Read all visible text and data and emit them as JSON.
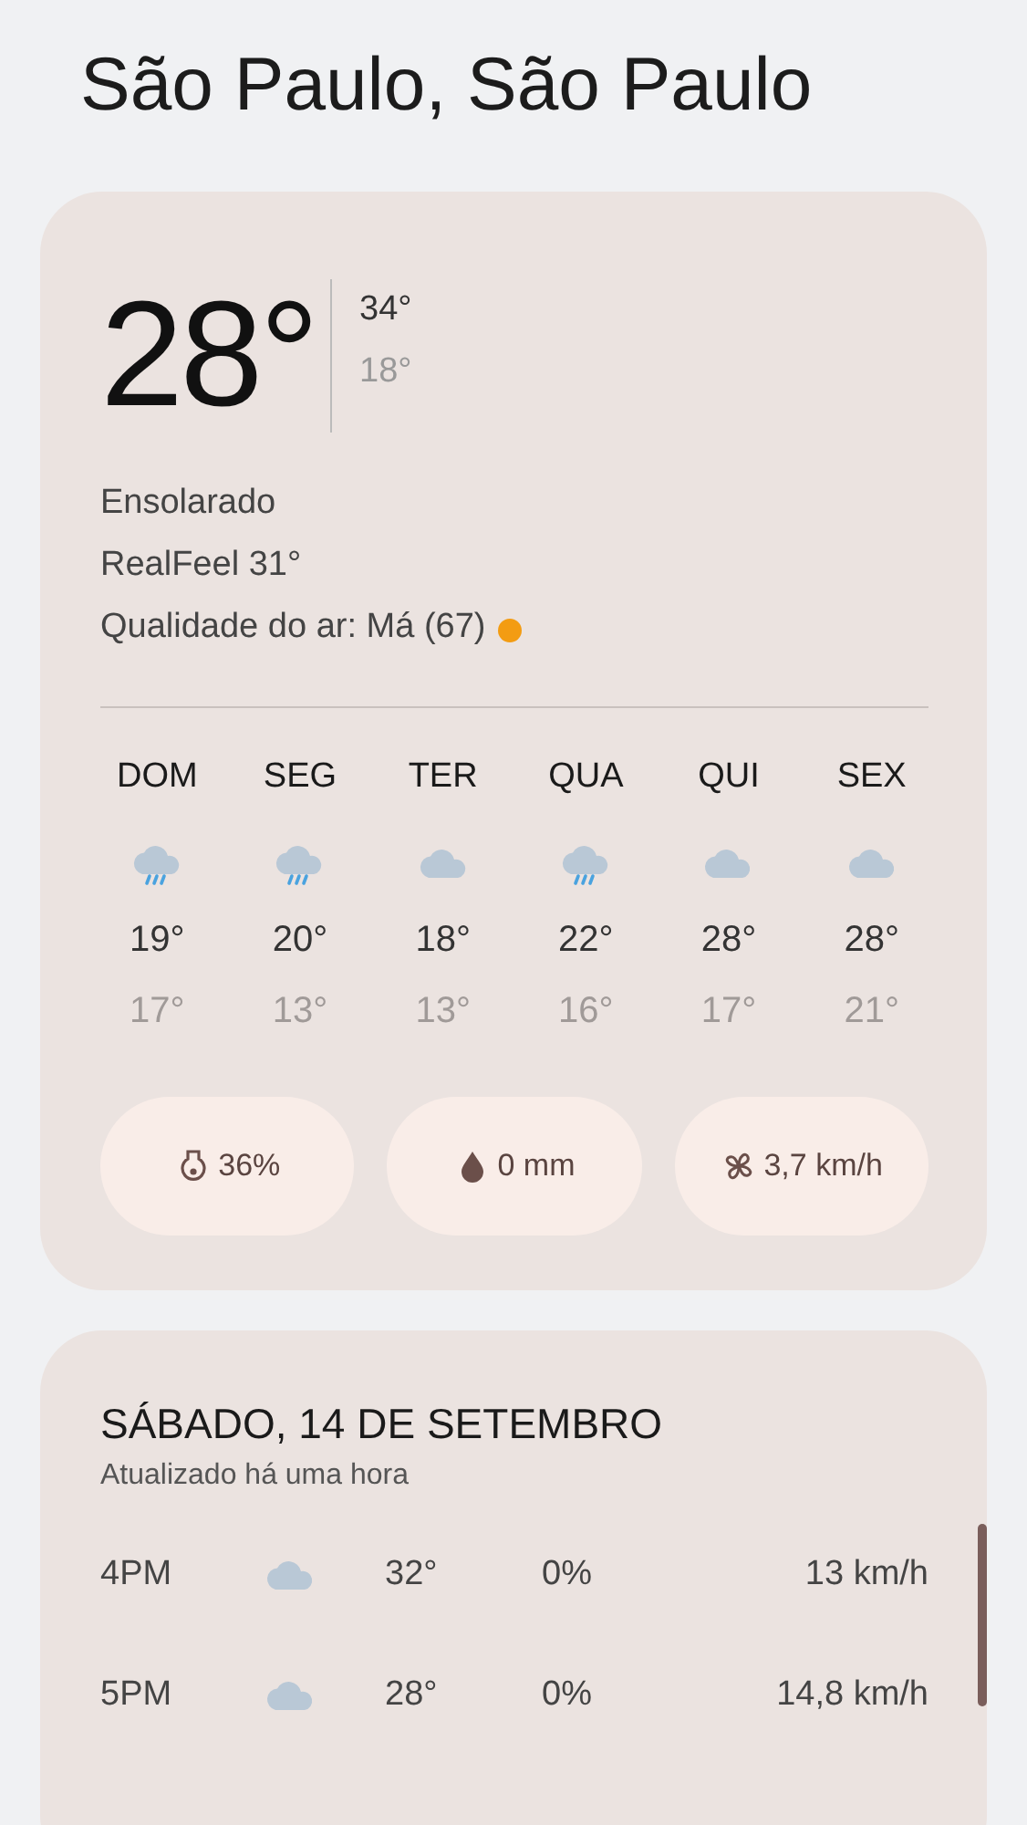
{
  "location": "São Paulo, São Paulo",
  "current": {
    "temperature": "28°",
    "high": "34°",
    "low": "18°",
    "condition": "Ensolarado",
    "realfeel": "RealFeel 31°",
    "air_quality": {
      "label": "Qualidade do ar: Má (67)",
      "color": "#f39c12"
    }
  },
  "forecast": [
    {
      "day": "DOM",
      "kind": "rain",
      "high": "19°",
      "low": "17°"
    },
    {
      "day": "SEG",
      "kind": "rain",
      "high": "20°",
      "low": "13°"
    },
    {
      "day": "TER",
      "kind": "cloud",
      "high": "18°",
      "low": "13°"
    },
    {
      "day": "QUA",
      "kind": "rain",
      "high": "22°",
      "low": "16°"
    },
    {
      "day": "QUI",
      "kind": "cloud",
      "high": "28°",
      "low": "17°"
    },
    {
      "day": "SEX",
      "kind": "cloud",
      "high": "28°",
      "low": "21°"
    }
  ],
  "stats": [
    {
      "kind": "humidity",
      "value": "36%"
    },
    {
      "kind": "precipitation",
      "value": "0 mm"
    },
    {
      "kind": "wind",
      "value": "3,7 km/h"
    }
  ],
  "hourly": {
    "title": "SÁBADO, 14 DE SETEMBRO",
    "updated": "Atualizado há uma hora",
    "rows": [
      {
        "time": "4PM",
        "kind": "cloud",
        "temperature": "32°",
        "precipitation": "0%",
        "wind": "13 km/h"
      },
      {
        "time": "5PM",
        "kind": "cloud",
        "temperature": "28°",
        "precipitation": "0%",
        "wind": "14,8 km/h"
      }
    ]
  }
}
